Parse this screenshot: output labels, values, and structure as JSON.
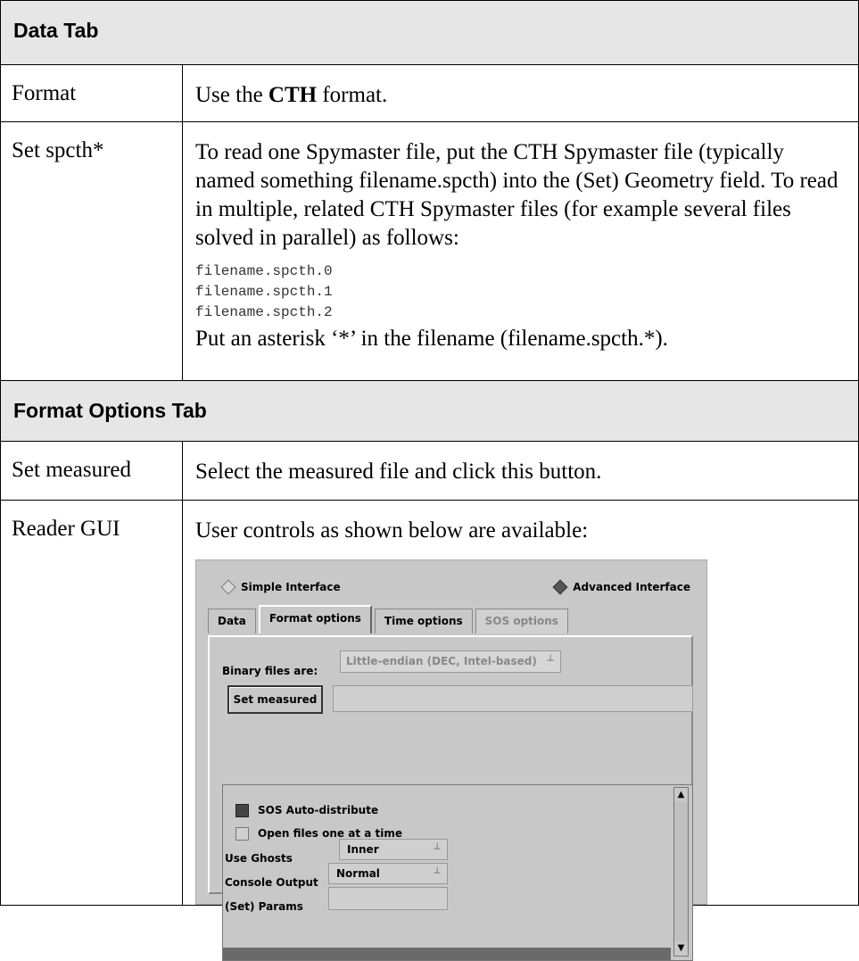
{
  "sections": {
    "data_tab": {
      "title": "Data Tab",
      "rows": [
        {
          "label": "Format",
          "text_pre": "Use the ",
          "text_bold": "CTH",
          "text_post": " format."
        },
        {
          "label": "Set spcth*",
          "para1": "To read one Spymaster file, put the CTH Spymaster file (typically named something filename.spcth) into the (Set) Geometry field. To read in multiple, related CTH Spymaster files (for example several files solved in parallel) as follows:",
          "code": [
            "filename.spcth.0",
            "filename.spcth.1",
            "filename.spcth.2"
          ],
          "para2": "Put an asterisk ‘*’ in the filename (filename.spcth.*)."
        }
      ]
    },
    "format_options_tab": {
      "title": "Format Options Tab",
      "rows": [
        {
          "label": "Set measured",
          "text": "Select the measured file and click this button."
        },
        {
          "label": "Reader GUI",
          "text": "User controls as shown below are available:"
        }
      ]
    }
  },
  "gui": {
    "radio_simple": "Simple Interface",
    "radio_advanced": "Advanced Interface",
    "tabs": [
      "Data",
      "Format options",
      "Time options",
      "SOS options"
    ],
    "binary_label": "Binary files are:",
    "binary_value": "Little-endian (DEC, Intel-based)",
    "set_measured_button": "Set measured",
    "sos_auto": "SOS Auto-distribute",
    "open_files": "Open files one at a time",
    "use_ghosts_label": "Use Ghosts",
    "use_ghosts_value": "Inner",
    "console_label": "Console Output",
    "console_value": "Normal",
    "params_label": "(Set) Params"
  },
  "colors": {
    "header_bg": "#e6e6e6",
    "gui_bg": "#c8c8c8"
  }
}
